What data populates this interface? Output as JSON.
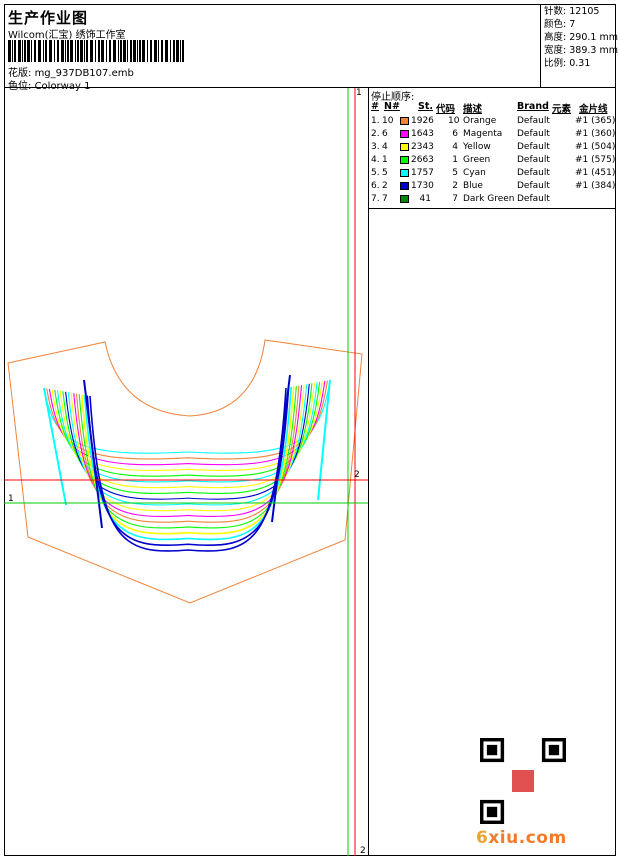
{
  "header": {
    "title": "生产作业图",
    "company": "Wilcom(汇宝) 绣饰工作室",
    "design_label": "花版:",
    "design_value": "mg_937DB107.emb",
    "colorway_label": "色位:",
    "colorway_value": "Colorway 1"
  },
  "stats": [
    {
      "label": "针数:",
      "value": "12105"
    },
    {
      "label": "颜色:",
      "value": "7"
    },
    {
      "label": "高度:",
      "value": "290.1 mm"
    },
    {
      "label": "宽度:",
      "value": "389.3 mm"
    },
    {
      "label": "比例:",
      "value": "0.31"
    }
  ],
  "stop_sequence": {
    "title": "停止顺序:",
    "columns": [
      "#",
      "N#",
      "St.",
      "代码",
      "描述",
      "Brand",
      "元素",
      "金片线"
    ],
    "rows": [
      {
        "idx": "1.",
        "n": "10",
        "color": "#f0843a",
        "st": "1926",
        "code": "10",
        "desc": "Orange",
        "brand": "Default",
        "elem": "#1 (365)"
      },
      {
        "idx": "2.",
        "n": "6",
        "color": "#ff00ff",
        "st": "1643",
        "code": "6",
        "desc": "Magenta",
        "brand": "Default",
        "elem": "#1 (360)"
      },
      {
        "idx": "3.",
        "n": "4",
        "color": "#ffff00",
        "st": "2343",
        "code": "4",
        "desc": "Yellow",
        "brand": "Default",
        "elem": "#1 (504)"
      },
      {
        "idx": "4.",
        "n": "1",
        "color": "#00ff00",
        "st": "2663",
        "code": "1",
        "desc": "Green",
        "brand": "Default",
        "elem": "#1 (575)"
      },
      {
        "idx": "5.",
        "n": "5",
        "color": "#00ffff",
        "st": "1757",
        "code": "5",
        "desc": "Cyan",
        "brand": "Default",
        "elem": "#1 (451)"
      },
      {
        "idx": "6.",
        "n": "2",
        "color": "#0000cc",
        "st": "1730",
        "code": "2",
        "desc": "Blue",
        "brand": "Default",
        "elem": "#1 (384)"
      },
      {
        "idx": "7.",
        "n": "7",
        "color": "#008800",
        "st": "41",
        "code": "7",
        "desc": "Dark Green",
        "brand": "Default",
        "elem": ""
      }
    ]
  },
  "axis_labels": {
    "top_right": "1",
    "h_right": "2",
    "left": "1",
    "bottom_right": "2"
  },
  "watermark": {
    "text_num": "6",
    "text_rest": "xiu.com"
  },
  "stitch_colors": [
    "#f0843a",
    "#ff00ff",
    "#ffff00",
    "#00ff00",
    "#00ffff",
    "#0000cc",
    "#008800"
  ]
}
